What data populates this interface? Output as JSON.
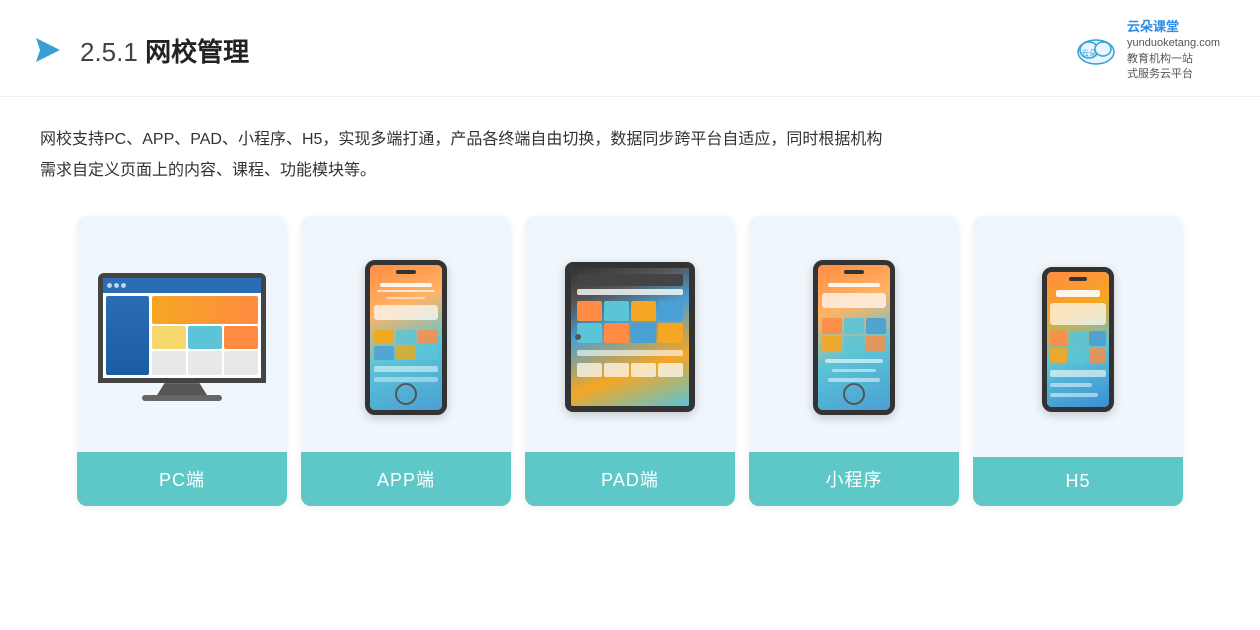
{
  "header": {
    "section_number": "2.5.1",
    "title": "网校管理",
    "brand": {
      "name": "云朵课堂",
      "site": "yunduoketang.com",
      "tagline_line1": "教育机构一站",
      "tagline_line2": "式服务云平台"
    }
  },
  "description": {
    "text_line1": "网校支持PC、APP、PAD、小程序、H5，实现多端打通，产品各终端自由切换，数据同步跨平台自适应，同时根据机构",
    "text_line2": "需求自定义页面上的内容、课程、功能模块等。"
  },
  "cards": [
    {
      "id": "pc",
      "label": "PC端"
    },
    {
      "id": "app",
      "label": "APP端"
    },
    {
      "id": "pad",
      "label": "PAD端"
    },
    {
      "id": "miniprogram",
      "label": "小程序"
    },
    {
      "id": "h5",
      "label": "H5"
    }
  ],
  "colors": {
    "card_bg": "#eef6fb",
    "card_label_bg": "#5ec8c8",
    "title_color": "#222222",
    "accent_blue": "#2a8be8"
  }
}
